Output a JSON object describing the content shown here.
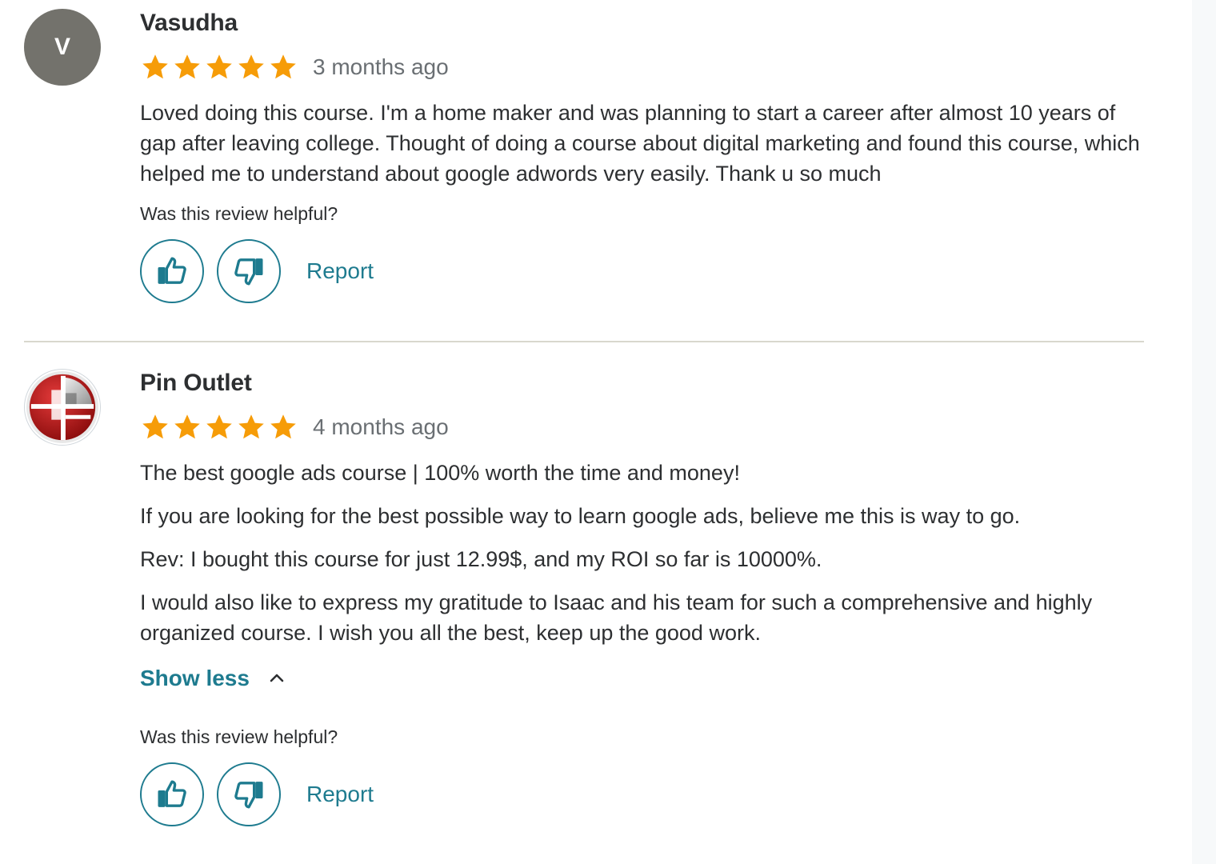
{
  "reviews": [
    {
      "avatar_initial": "V",
      "name": "Vasudha",
      "rating": 5,
      "date": "3 months ago",
      "paragraphs": [
        "Loved doing this course. I'm a home maker and was planning to start a career after almost 10 years of gap after leaving college. Thought of doing a course about digital marketing and found this course, which helped me to understand about google adwords very easily. Thank u so much"
      ],
      "helpful_prompt": "Was this review helpful?",
      "report_label": "Report"
    },
    {
      "avatar_icon": "pin-outlet-logo-icon",
      "name": "Pin Outlet",
      "rating": 5,
      "date": "4 months ago",
      "paragraphs": [
        "The best google ads course | 100% worth the time and money!",
        "If you are looking for the best possible way to learn google ads, believe me this is way to go.",
        "Rev: I bought this course for just 12.99$, and my ROI so far is 10000%.",
        "I would also like to express my gratitude to Isaac and his team for such a comprehensive and highly organized course. I wish you all the best, keep up the good work."
      ],
      "show_less_label": "Show less",
      "helpful_prompt": "Was this review helpful?",
      "report_label": "Report"
    }
  ],
  "colors": {
    "star": "#f69c08",
    "link": "#1e7b8f",
    "avatar_bg": "#73726c",
    "divider": "#d9d8ce"
  },
  "icons": {
    "star": "star-icon",
    "thumbs_up": "thumbs-up-icon",
    "thumbs_down": "thumbs-down-icon",
    "chevron": "chevron-up-icon"
  }
}
